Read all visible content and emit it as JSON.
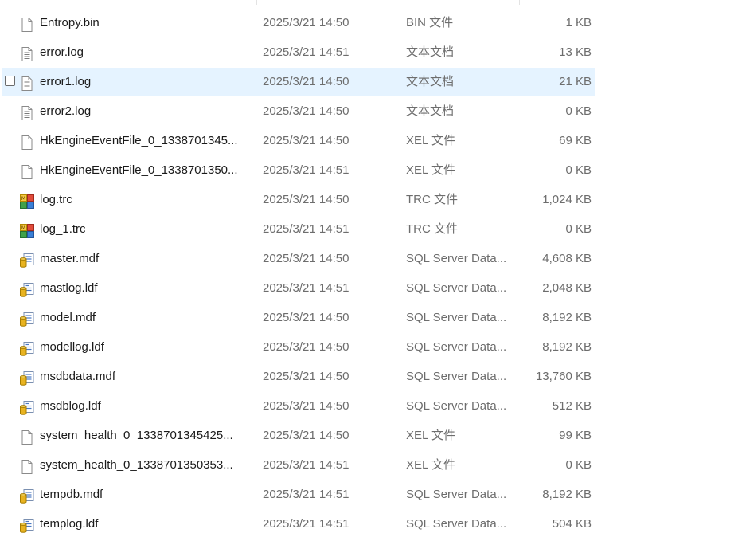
{
  "files": [
    {
      "name": "Entropy.bin",
      "date": "2025/3/21 14:50",
      "type": "BIN 文件",
      "size": "1 KB",
      "icon": "blank-file-icon",
      "selected": false
    },
    {
      "name": "error.log",
      "date": "2025/3/21 14:51",
      "type": "文本文档",
      "size": "13 KB",
      "icon": "text-file-icon",
      "selected": false
    },
    {
      "name": "error1.log",
      "date": "2025/3/21 14:50",
      "type": "文本文档",
      "size": "21 KB",
      "icon": "text-file-icon",
      "selected": true
    },
    {
      "name": "error2.log",
      "date": "2025/3/21 14:50",
      "type": "文本文档",
      "size": "0 KB",
      "icon": "text-file-icon",
      "selected": false
    },
    {
      "name": "HkEngineEventFile_0_1338701345...",
      "date": "2025/3/21 14:50",
      "type": "XEL 文件",
      "size": "69 KB",
      "icon": "blank-file-icon",
      "selected": false
    },
    {
      "name": "HkEngineEventFile_0_1338701350...",
      "date": "2025/3/21 14:51",
      "type": "XEL 文件",
      "size": "0 KB",
      "icon": "blank-file-icon",
      "selected": false
    },
    {
      "name": "log.trc",
      "date": "2025/3/21 14:50",
      "type": "TRC 文件",
      "size": "1,024 KB",
      "icon": "trace-file-icon",
      "selected": false
    },
    {
      "name": "log_1.trc",
      "date": "2025/3/21 14:51",
      "type": "TRC 文件",
      "size": "0 KB",
      "icon": "trace-file-icon",
      "selected": false
    },
    {
      "name": "master.mdf",
      "date": "2025/3/21 14:50",
      "type": "SQL Server Data...",
      "size": "4,608 KB",
      "icon": "sql-data-file-icon",
      "selected": false
    },
    {
      "name": "mastlog.ldf",
      "date": "2025/3/21 14:51",
      "type": "SQL Server Data...",
      "size": "2,048 KB",
      "icon": "sql-log-file-icon",
      "selected": false
    },
    {
      "name": "model.mdf",
      "date": "2025/3/21 14:50",
      "type": "SQL Server Data...",
      "size": "8,192 KB",
      "icon": "sql-data-file-icon",
      "selected": false
    },
    {
      "name": "modellog.ldf",
      "date": "2025/3/21 14:50",
      "type": "SQL Server Data...",
      "size": "8,192 KB",
      "icon": "sql-log-file-icon",
      "selected": false
    },
    {
      "name": "msdbdata.mdf",
      "date": "2025/3/21 14:50",
      "type": "SQL Server Data...",
      "size": "13,760 KB",
      "icon": "sql-data-file-icon",
      "selected": false
    },
    {
      "name": "msdblog.ldf",
      "date": "2025/3/21 14:50",
      "type": "SQL Server Data...",
      "size": "512 KB",
      "icon": "sql-log-file-icon",
      "selected": false
    },
    {
      "name": "system_health_0_1338701345425...",
      "date": "2025/3/21 14:50",
      "type": "XEL 文件",
      "size": "99 KB",
      "icon": "blank-file-icon",
      "selected": false
    },
    {
      "name": "system_health_0_1338701350353...",
      "date": "2025/3/21 14:51",
      "type": "XEL 文件",
      "size": "0 KB",
      "icon": "blank-file-icon",
      "selected": false
    },
    {
      "name": "tempdb.mdf",
      "date": "2025/3/21 14:51",
      "type": "SQL Server Data...",
      "size": "8,192 KB",
      "icon": "sql-data-file-icon",
      "selected": false
    },
    {
      "name": "templog.ldf",
      "date": "2025/3/21 14:51",
      "type": "SQL Server Data...",
      "size": "504 KB",
      "icon": "sql-log-file-icon",
      "selected": false
    }
  ],
  "colors": {
    "selection": "#e5f3ff",
    "secondary_text": "#6d6d6d",
    "sql_icon": "#e8b320"
  }
}
